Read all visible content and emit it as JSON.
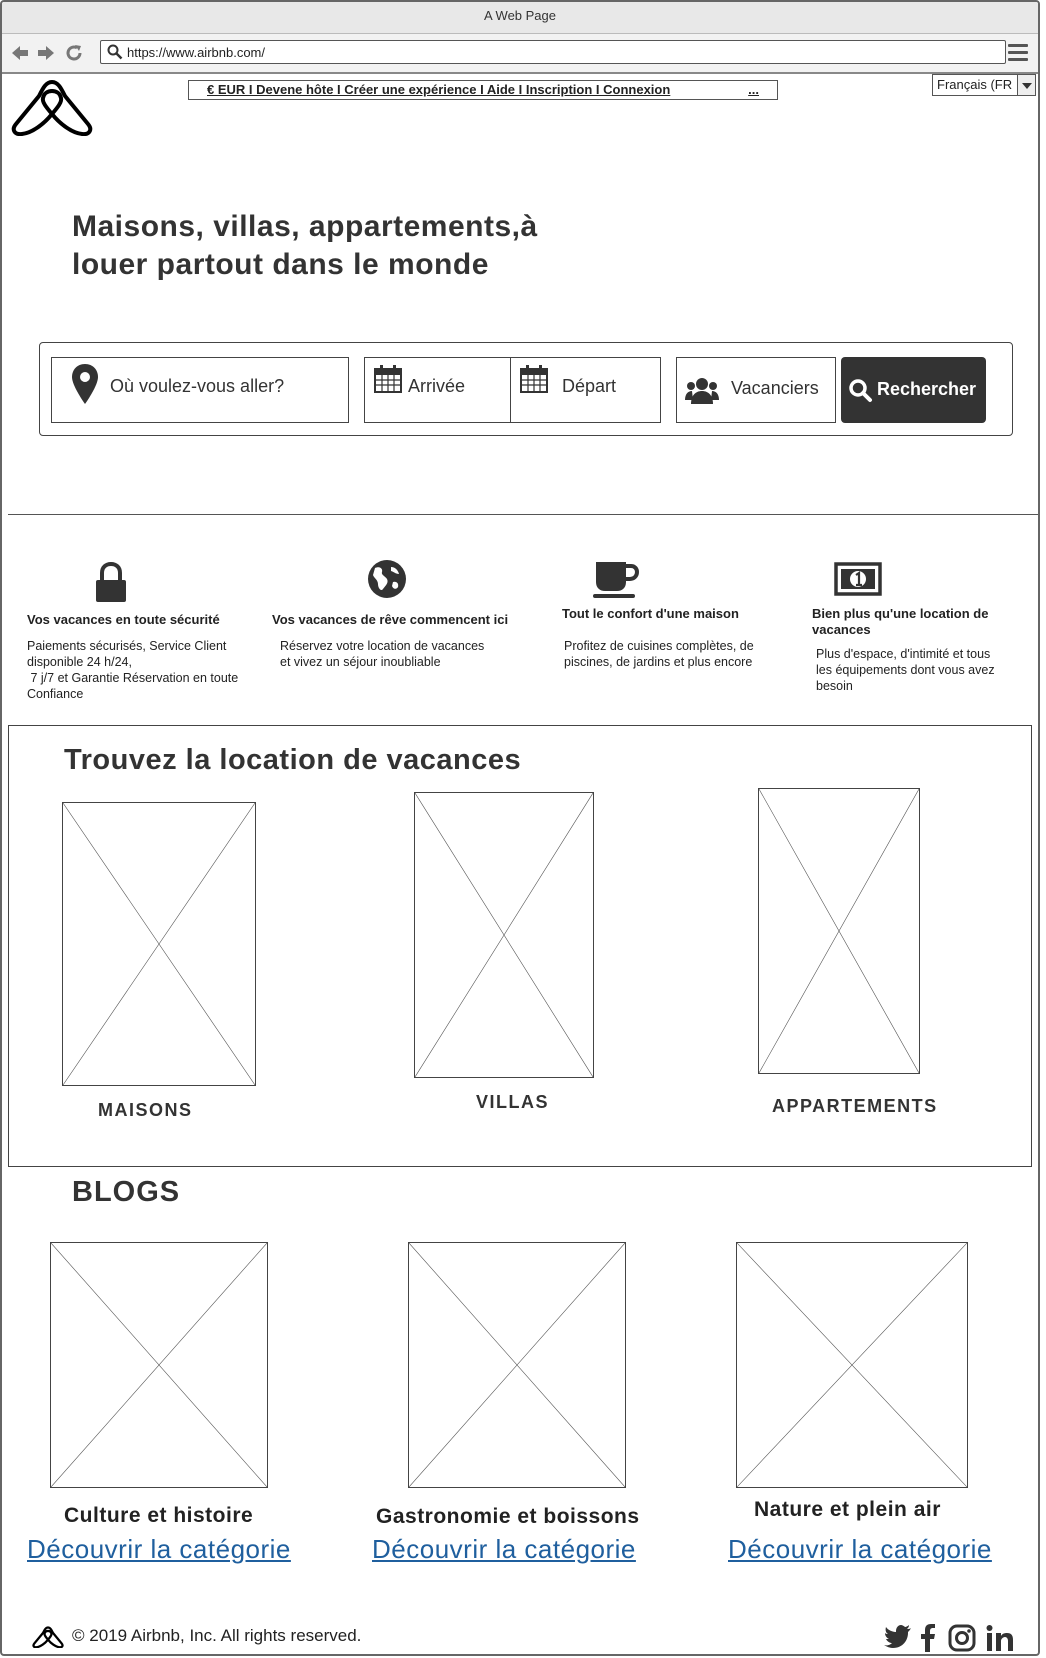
{
  "browser": {
    "window_title": "A Web Page",
    "url": "https://www.airbnb.com/"
  },
  "header": {
    "top_links": "€ EUR I Devene hôte I Créer une expérience  I Aide I Inscription I Connexion",
    "more": "...",
    "language": "Français (FR"
  },
  "hero": {
    "title_line1": "Maisons, villas, appartements,à",
    "title_line2": "louer partout dans le monde"
  },
  "search": {
    "where_placeholder": "Où voulez-vous aller?",
    "arrival": "Arrivée",
    "departure": "Départ",
    "guests": "Vacanciers",
    "button": "Rechercher"
  },
  "features": [
    {
      "icon": "lock-icon",
      "title": "Vos vacances en toute sécurité",
      "text": [
        "Paiements sécurisés, Service Client",
        "disponible 24 h/24,",
        " 7 j/7 et Garantie Réservation en toute",
        "Confiance"
      ]
    },
    {
      "icon": "globe-icon",
      "title": "Vos vacances de rêve commencent ici",
      "text": [
        "Réservez votre location de vacances",
        "et vivez un séjour inoubliable"
      ]
    },
    {
      "icon": "coffee-cup-icon",
      "title": "Tout le confort d'une maison",
      "text": [
        "Profitez de cuisines complètes, de",
        "piscines, de jardins et plus encore"
      ]
    },
    {
      "icon": "money-bill-icon",
      "title_line1": "Bien plus qu'une location de",
      "title_line2": "vacances",
      "text": [
        "Plus d'espace, d'intimité et tous",
        "les équipements dont vous avez",
        "besoin"
      ]
    }
  ],
  "locations": {
    "title": "Trouvez la location de vacances",
    "items": [
      "MAISONS",
      "VILLAS",
      "APPARTEMENTS"
    ]
  },
  "blogs": {
    "title": "BLOGS",
    "items": [
      {
        "caption": "Culture et histoire",
        "link": "Découvrir la catégorie"
      },
      {
        "caption": "Gastronomie et boissons",
        "link": "Découvrir la catégorie"
      },
      {
        "caption": "Nature et plein air",
        "link": "Découvrir la catégorie"
      }
    ]
  },
  "footer": {
    "copyright": "© 2019 Airbnb, Inc. All rights reserved.",
    "social": [
      "twitter-icon",
      "facebook-icon",
      "instagram-icon",
      "linkedin-icon"
    ]
  },
  "colors": {
    "link": "#1f5f9e",
    "button_bg": "#333333",
    "text": "#222222"
  }
}
